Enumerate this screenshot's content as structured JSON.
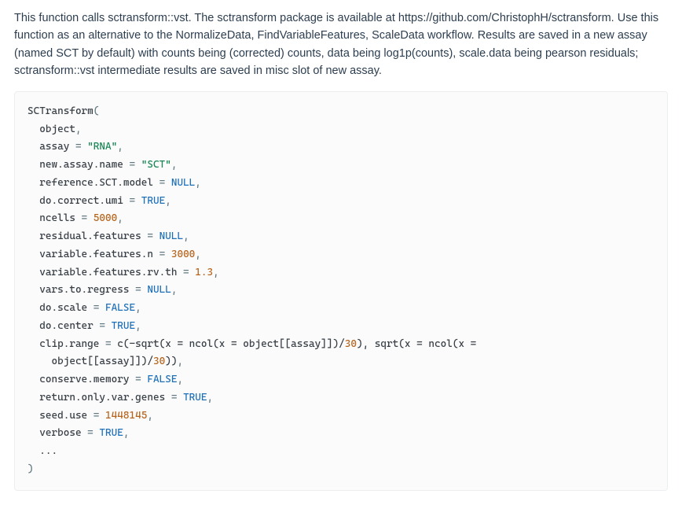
{
  "description": {
    "text": "This function calls sctransform::vst. The sctransform package is available at https://github.com/ChristophH/sctransform. Use this function as an alternative to the NormalizeData, FindVariableFeatures, ScaleData workflow. Results are saved in a new assay (named SCT by default) with counts being (corrected) counts, data being log1p(counts), scale.data being pearson residuals; sctransform::vst intermediate results are saved in misc slot of new assay."
  },
  "code": {
    "fn_name": "SCTransform",
    "open_paren": "(",
    "close_paren": ")",
    "args": {
      "object": "object",
      "assay": {
        "name": "assay",
        "eq": " = ",
        "val": "\"RNA\"",
        "type": "str"
      },
      "new_assay_name": {
        "name": "new.assay.name",
        "eq": " = ",
        "val": "\"SCT\"",
        "type": "str"
      },
      "reference_sct_model": {
        "name": "reference.SCT.model",
        "eq": " = ",
        "val": "NULL",
        "type": "kw"
      },
      "do_correct_umi": {
        "name": "do.correct.umi",
        "eq": " = ",
        "val": "TRUE",
        "type": "kw"
      },
      "ncells": {
        "name": "ncells",
        "eq": " = ",
        "val": "5000",
        "type": "num"
      },
      "residual_features": {
        "name": "residual.features",
        "eq": " = ",
        "val": "NULL",
        "type": "kw"
      },
      "variable_features_n": {
        "name": "variable.features.n",
        "eq": " = ",
        "val": "3000",
        "type": "num"
      },
      "variable_features_rv": {
        "name": "variable.features.rv.th",
        "eq": " = ",
        "val": "1.3",
        "type": "num"
      },
      "vars_to_regress": {
        "name": "vars.to.regress",
        "eq": " = ",
        "val": "NULL",
        "type": "kw"
      },
      "do_scale": {
        "name": "do.scale",
        "eq": " = ",
        "val": "FALSE",
        "type": "kw"
      },
      "do_center": {
        "name": "do.center",
        "eq": " = ",
        "val": "TRUE",
        "type": "kw"
      },
      "clip_range": {
        "name": "clip.range",
        "eq": " = ",
        "pre": "c(-sqrt(x = ncol(x = object[[assay]])/",
        "num1": "30",
        "mid": "), sqrt(x = ncol(x =",
        "line2_pre": "    object[[assay]])/",
        "num2": "30",
        "post": "))"
      },
      "conserve_memory": {
        "name": "conserve.memory",
        "eq": " = ",
        "val": "FALSE",
        "type": "kw"
      },
      "return_only_var": {
        "name": "return.only.var.genes",
        "eq": " = ",
        "val": "TRUE",
        "type": "kw"
      },
      "seed_use": {
        "name": "seed.use",
        "eq": " = ",
        "val": "1448145",
        "type": "num"
      },
      "verbose": {
        "name": "verbose",
        "eq": " = ",
        "val": "TRUE",
        "type": "kw"
      },
      "dots": "..."
    },
    "comma": ","
  }
}
